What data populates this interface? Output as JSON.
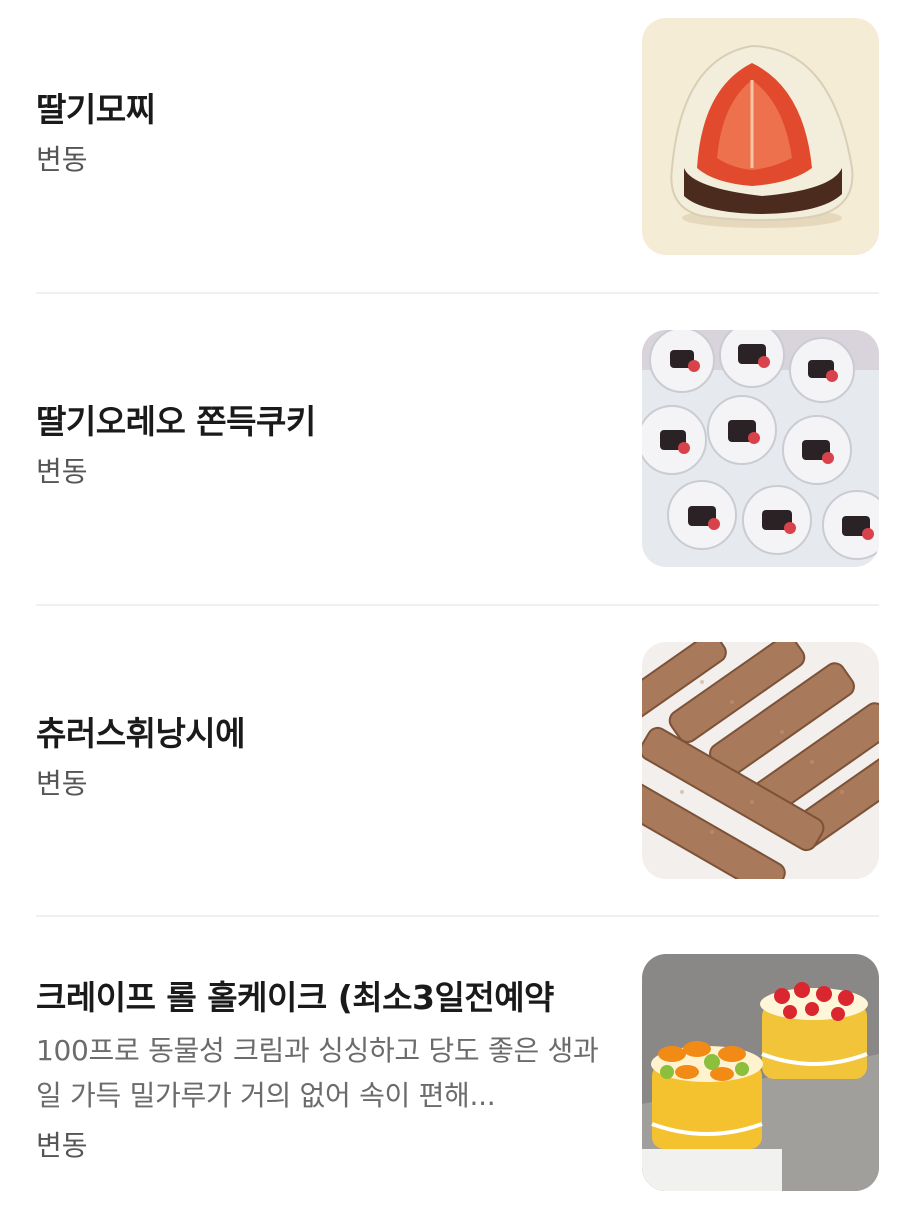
{
  "menu": {
    "items": [
      {
        "name": "딸기모찌",
        "description": "",
        "price": "변동",
        "image_icon": "strawberry-mochi-photo"
      },
      {
        "name": "딸기오레오 쫀득쿠키",
        "description": "",
        "price": "변동",
        "image_icon": "strawberry-oreo-cookie-photo"
      },
      {
        "name": "츄러스휘낭시에",
        "description": "",
        "price": "변동",
        "image_icon": "churros-financier-photo"
      },
      {
        "name": "크레이프 롤 홀케이크 (최소3일전예약",
        "description": "100프로 동물성 크림과 싱싱하고 당도 좋은 생과일 가득 밀가루가 거의 없어 속이 편해...",
        "price": "변동",
        "image_icon": "crepe-roll-cake-photo"
      }
    ]
  }
}
